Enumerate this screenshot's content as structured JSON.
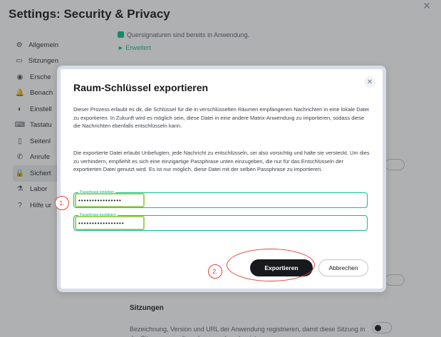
{
  "settings": {
    "title": "Settings: Security & Privacy",
    "close_icon": "close-icon",
    "sidebar": [
      {
        "label": "Allgemein",
        "icon": "gear-icon"
      },
      {
        "label": "Sitzungen",
        "icon": "devices-icon"
      },
      {
        "label": "Ersche",
        "icon": "eye-icon"
      },
      {
        "label": "Benach",
        "icon": "bell-icon"
      },
      {
        "label": "Einstell",
        "icon": "toggle-icon"
      },
      {
        "label": "Tastatu",
        "icon": "keyboard-icon"
      },
      {
        "label": "Seitenl",
        "icon": "sidebar-icon"
      },
      {
        "label": "Anrufe",
        "icon": "phone-icon"
      },
      {
        "label": "Sichert",
        "icon": "lock-icon"
      },
      {
        "label": "Labor",
        "icon": "flask-icon"
      },
      {
        "label": "Hilfe ur",
        "icon": "help-icon"
      }
    ],
    "cross_signing_text": "Quersignaturen sind bereits in Anwendung.",
    "advanced_link": "► Erweitert",
    "sessions_heading": "Sitzungen",
    "sessions_desc": "Bezeichnung, Version und URL der Anwendung registrieren, damit diese Sitzung in der Sitzungsverwaltung besser erkennbar ist"
  },
  "dialog": {
    "title": "Raum-Schlüssel exportieren",
    "close_icon": "close-icon",
    "paragraph_1": "Dieser Prozess erlaubt es dir, die Schlüssel für die in verschlüsselten Räumen empfangenen Nachrichten in eine lokale Datei zu exportieren. In Zukunft wird es möglich sein, diese Datei in eine andere Matrix-Anwendung zu importieren, sodass diese die Nachrichten ebenfalls entschlüsseln kann.",
    "paragraph_2": "Die exportierte Datei erlaubt Unbefugten, jede Nachricht zu entschlüsseln, sei also vorsichtig und halte sie versteckt. Um dies zu verhindern, empfiehlt es sich eine einzigartige Passphrase unten einzugeben, die nur für das Entschlüsseln der exportierten Datei genutzt wird. Es ist nur möglich, diese Datei mit der selben Passphrase zu importieren.",
    "passphrase_label": "Passphrase eingeben",
    "passphrase_value": "••••••••••••••••",
    "confirm_label": "Passphrase bestätigen",
    "confirm_value": "•••••••••••••••••",
    "export_button": "Exportieren",
    "cancel_button": "Abbrechen"
  },
  "annotations": {
    "step_1": "1.",
    "step_2": "2.",
    "highlight_color_fields": "#9fd45a",
    "highlight_color_steps": "#e0443e"
  }
}
